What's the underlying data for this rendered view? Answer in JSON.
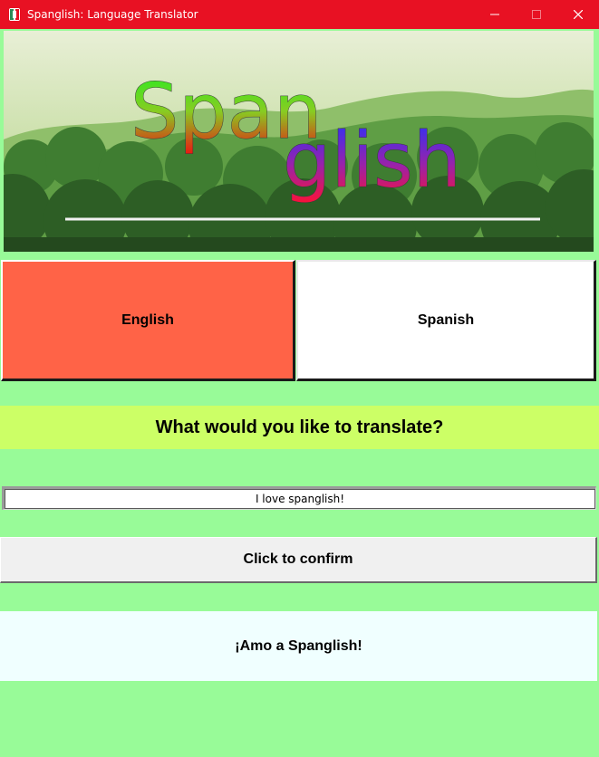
{
  "window": {
    "title": "Spanglish: Language Translator",
    "icon": "app-icon",
    "controls": [
      "minimize-icon",
      "maximize-icon",
      "close-icon"
    ]
  },
  "banner": {
    "logo_part1": "Span",
    "logo_part2": "glish"
  },
  "languages": {
    "english": "English",
    "spanish": "Spanish",
    "selected": "English"
  },
  "prompt": {
    "label": "What would you like to translate?"
  },
  "input": {
    "value": "I love spanglish!"
  },
  "confirm": {
    "label": "Click to confirm"
  },
  "result": {
    "text": "¡Amo a Spanglish!"
  },
  "colors": {
    "titlebar": "#e81123",
    "background": "#98fb98",
    "selected_language": "#ff6347",
    "unselected_language": "#ffffff",
    "prompt_band": "#ccff66",
    "confirm_button": "#f0f0f0",
    "result_box": "#f0ffff"
  }
}
